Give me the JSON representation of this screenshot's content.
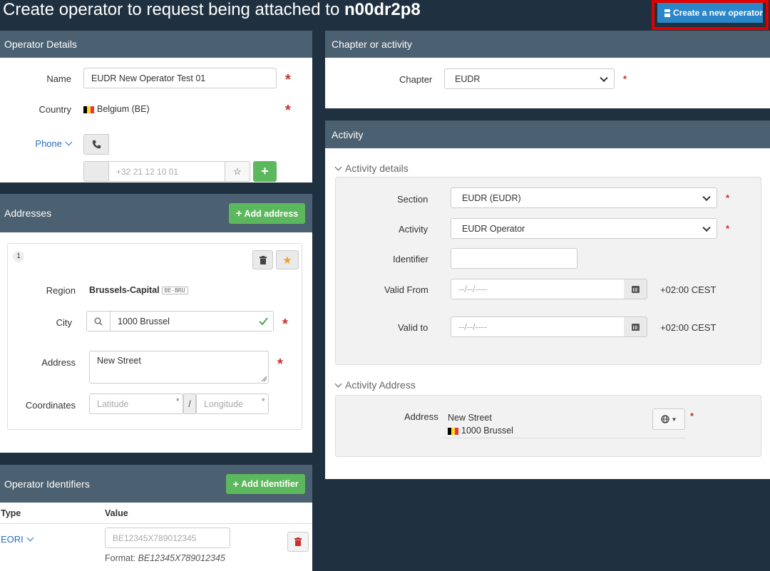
{
  "page": {
    "title_prefix": "Create operator to request being attached to",
    "title_code": "n00dr2p8",
    "create_button": "Create a new operator"
  },
  "operator_details": {
    "heading": "Operator Details",
    "name_label": "Name",
    "name_value": "EUDR New Operator Test 01",
    "country_label": "Country",
    "country_value": "Belgium (BE)",
    "phone_label": "Phone",
    "phone_placeholder": "+32 21 12 10 01",
    "add_phone": "+"
  },
  "addresses": {
    "heading": "Addresses",
    "add_button": "Add address",
    "item_number": "1",
    "region_label": "Region",
    "region_value": "Brussels-Capital",
    "region_code": "BE-BRU",
    "city_label": "City",
    "city_value": "1000 Brussel",
    "address_label": "Address",
    "address_value": "New Street",
    "coordinates_label": "Coordinates",
    "latitude_placeholder": "Latitude",
    "longitude_placeholder": "Longitude",
    "degree": "°",
    "separator": "/"
  },
  "identifiers": {
    "heading": "Operator Identifiers",
    "add_button": "Add Identifier",
    "col_type": "Type",
    "col_value": "Value",
    "type_value": "EORI",
    "value_placeholder": "BE12345X789012345",
    "format_label": "Format:",
    "format_value": "BE12345X789012345"
  },
  "chapter": {
    "heading": "Chapter or activity",
    "chapter_label": "Chapter",
    "chapter_value": "EUDR"
  },
  "activity": {
    "heading": "Activity",
    "details_toggle": "Activity details",
    "section_label": "Section",
    "section_value": "EUDR (EUDR)",
    "activity_label": "Activity",
    "activity_value": "EUDR Operator",
    "identifier_label": "Identifier",
    "valid_from_label": "Valid From",
    "valid_to_label": "Valid to",
    "date_placeholder": "--/--/----",
    "timezone": "+02:00 CEST",
    "address_toggle": "Activity Address",
    "address_label": "Address",
    "address_line1": "New Street",
    "address_line2": "1000 Brussel"
  },
  "colors": {
    "background": "#1f3140",
    "panel_header": "#4b6070",
    "primary_blue": "#2b86c8",
    "success_green": "#5cb85c",
    "required_red": "#c9302c",
    "delete_red": "#c9302c",
    "star_orange": "#f0a020",
    "highlight_frame": "#e00000"
  }
}
